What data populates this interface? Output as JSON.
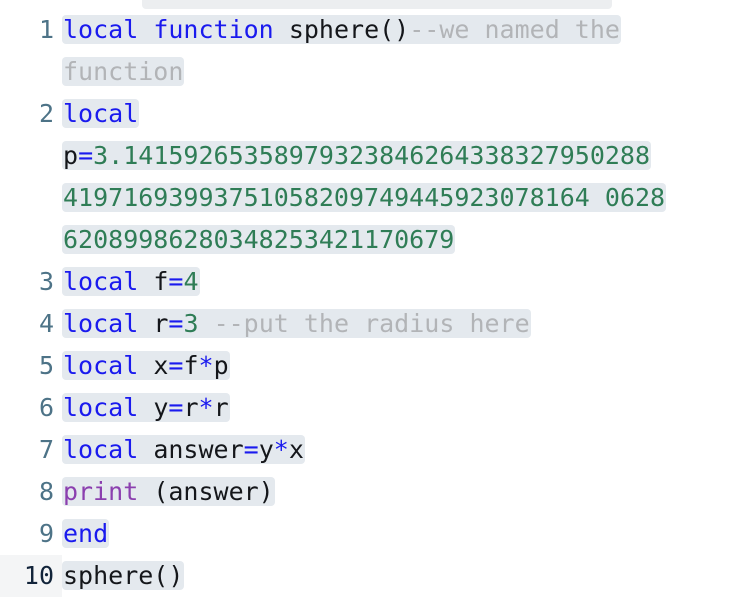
{
  "editor": {
    "language": "lua",
    "colors": {
      "background": "#ffffff",
      "selection": "#e4e9ee",
      "gutter_text": "#4d7387",
      "gutter_active_text": "#12243a",
      "gutter_active_bg": "#f4f5f6",
      "keyword": "#1a1aee",
      "number": "#2f7d56",
      "operator": "#1a1aee",
      "identifier": "#14161a",
      "comment": "#b2b4b7",
      "builtin_function": "#8b3faf"
    },
    "active_line": 10,
    "lines": [
      {
        "number": "1",
        "tokens": [
          {
            "t": "local",
            "c": "kw"
          },
          {
            "t": " ",
            "c": "id"
          },
          {
            "t": "function",
            "c": "kw"
          },
          {
            "t": " ",
            "c": "id"
          },
          {
            "t": "sphere()",
            "c": "id"
          },
          {
            "t": "--we named the",
            "c": "com"
          }
        ],
        "wrap": [
          {
            "t": "function",
            "c": "com"
          }
        ]
      },
      {
        "number": "2",
        "tokens": [
          {
            "t": "local",
            "c": "kw"
          }
        ],
        "wrap_rows": [
          [
            {
              "t": "p",
              "c": "id"
            },
            {
              "t": "=",
              "c": "op"
            },
            {
              "t": "3.14159265358979323846264338327950288",
              "c": "num"
            }
          ],
          [
            {
              "t": "41971693993751058209749445923078164 0628",
              "c": "num"
            }
          ],
          [
            {
              "t": "62089986280348253421170679",
              "c": "num"
            }
          ]
        ]
      },
      {
        "number": "3",
        "tokens": [
          {
            "t": "local",
            "c": "kw"
          },
          {
            "t": " ",
            "c": "id"
          },
          {
            "t": "f",
            "c": "id"
          },
          {
            "t": "=",
            "c": "op"
          },
          {
            "t": "4",
            "c": "num"
          }
        ]
      },
      {
        "number": "4",
        "tokens": [
          {
            "t": "local",
            "c": "kw"
          },
          {
            "t": " ",
            "c": "id"
          },
          {
            "t": "r",
            "c": "id"
          },
          {
            "t": "=",
            "c": "op"
          },
          {
            "t": "3",
            "c": "num"
          },
          {
            "t": " --put the radius here",
            "c": "com"
          }
        ]
      },
      {
        "number": "5",
        "tokens": [
          {
            "t": "local",
            "c": "kw"
          },
          {
            "t": " ",
            "c": "id"
          },
          {
            "t": "x",
            "c": "id"
          },
          {
            "t": "=",
            "c": "op"
          },
          {
            "t": "f",
            "c": "id"
          },
          {
            "t": "*",
            "c": "op"
          },
          {
            "t": "p",
            "c": "id"
          }
        ]
      },
      {
        "number": "6",
        "tokens": [
          {
            "t": "local",
            "c": "kw"
          },
          {
            "t": " ",
            "c": "id"
          },
          {
            "t": "y",
            "c": "id"
          },
          {
            "t": "=",
            "c": "op"
          },
          {
            "t": "r",
            "c": "id"
          },
          {
            "t": "*",
            "c": "op"
          },
          {
            "t": "r",
            "c": "id"
          }
        ]
      },
      {
        "number": "7",
        "tokens": [
          {
            "t": "local",
            "c": "kw"
          },
          {
            "t": " ",
            "c": "id"
          },
          {
            "t": "answer",
            "c": "id"
          },
          {
            "t": "=",
            "c": "op"
          },
          {
            "t": "y",
            "c": "id"
          },
          {
            "t": "*",
            "c": "op"
          },
          {
            "t": "x",
            "c": "id"
          }
        ]
      },
      {
        "number": "8",
        "tokens": [
          {
            "t": "print",
            "c": "fn"
          },
          {
            "t": " (answer)",
            "c": "id"
          }
        ]
      },
      {
        "number": "9",
        "tokens": [
          {
            "t": "end",
            "c": "kw"
          }
        ]
      },
      {
        "number": "10",
        "tokens": [
          {
            "t": "sphere()",
            "c": "id"
          }
        ]
      }
    ]
  }
}
